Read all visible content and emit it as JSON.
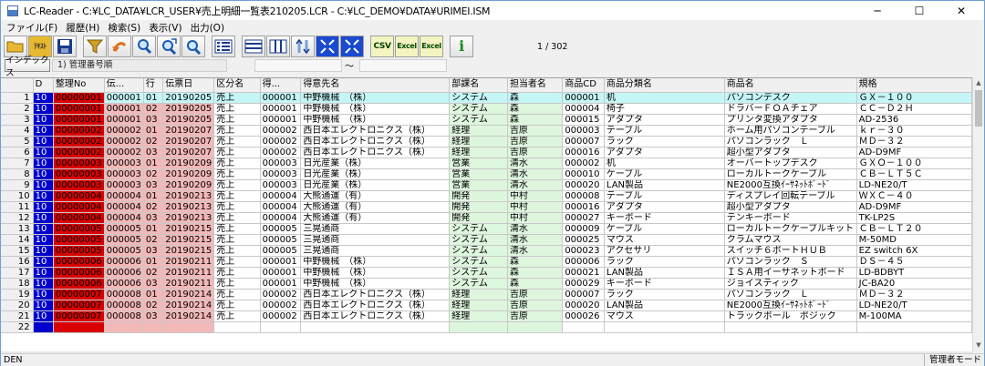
{
  "window": {
    "title": "LC-Reader - C:¥LC_DATA¥LCR_USER¥売上明細一覧表210205.LCR - C:¥LC_DEMO¥DATA¥URIMEI.ISM",
    "minimize": "─",
    "maximize": "☐",
    "close": "✕"
  },
  "menu": [
    "ファイル(F)",
    "履歴(H)",
    "検索(S)",
    "表示(V)",
    "出力(O)"
  ],
  "toolbar": {
    "buttons": [
      {
        "name": "folder-open-icon"
      },
      {
        "name": "folder-text-icon",
        "label": "ﾃｷｽﾄ"
      },
      {
        "name": "save-icon"
      },
      {
        "name": "filter-icon"
      },
      {
        "name": "undo-icon"
      },
      {
        "name": "search-icon"
      },
      {
        "name": "search-next-icon"
      },
      {
        "name": "search-prev-icon"
      },
      {
        "name": "list-icon"
      },
      {
        "name": "row-height-icon"
      },
      {
        "name": "column-width-icon"
      },
      {
        "name": "swap-icon"
      },
      {
        "name": "expand-icon"
      },
      {
        "name": "fit-icon"
      },
      {
        "name": "csv-icon",
        "label": "CSV"
      },
      {
        "name": "excel-icon",
        "label": "Excel"
      },
      {
        "name": "excel-template-icon",
        "label": "Excel"
      },
      {
        "name": "info-icon",
        "label": "i"
      }
    ],
    "page_indicator": "1 / 302"
  },
  "index": {
    "button": "インデックス",
    "name": "1) 管理番号順",
    "range_from": "",
    "range_sep": "～",
    "range_to": ""
  },
  "grid": {
    "columns": [
      "D",
      "整理No",
      "伝...",
      "行",
      "伝票日",
      "区分名",
      "得...",
      "得意先名",
      "部課名",
      "担当者名",
      "商品CD",
      "商品分類名",
      "商品名",
      "規格"
    ],
    "rows": [
      [
        "1",
        "10",
        "00000001",
        "000001",
        "01",
        "20190205",
        "売上",
        "000001",
        "中野機械　（株）",
        "システム",
        "森",
        "000001",
        "机",
        "パソコンデスク",
        "ＧＸ－１００"
      ],
      [
        "2",
        "10",
        "00000001",
        "000001",
        "02",
        "20190205",
        "売上",
        "000001",
        "中野機械　（株）",
        "システム",
        "森",
        "000004",
        "椅子",
        "ドラバーＦＯＡチェア",
        "ＣＣ－Ｄ２Ｈ"
      ],
      [
        "3",
        "10",
        "00000001",
        "000001",
        "03",
        "20190205",
        "売上",
        "000001",
        "中野機械　（株）",
        "システム",
        "森",
        "000015",
        "アダプタ",
        "プリンタ変換アダプタ",
        "AD-2536"
      ],
      [
        "4",
        "10",
        "00000002",
        "000002",
        "01",
        "20190207",
        "売上",
        "000002",
        "西日本エレクトロニクス（株）",
        "経理",
        "吉原",
        "000003",
        "テーブル",
        "ホーム用パソコンテーブル",
        "ｋｒ－３０"
      ],
      [
        "5",
        "10",
        "00000002",
        "000002",
        "02",
        "20190207",
        "売上",
        "000002",
        "西日本エレクトロニクス（株）",
        "経理",
        "吉原",
        "000007",
        "ラック",
        "パソコンラック　Ｌ",
        "ＭＤ－３２"
      ],
      [
        "6",
        "10",
        "00000002",
        "000002",
        "03",
        "20190207",
        "売上",
        "000002",
        "西日本エレクトロニクス（株）",
        "経理",
        "吉原",
        "000016",
        "アダプタ",
        "超小型アダプタ",
        "AD-D9MF"
      ],
      [
        "7",
        "10",
        "00000003",
        "000003",
        "01",
        "20190209",
        "売上",
        "000003",
        "日光産業（株）",
        "営業",
        "清水",
        "000002",
        "机",
        "オーバートップデスク",
        "ＧＸＯ－１００"
      ],
      [
        "8",
        "10",
        "00000003",
        "000003",
        "02",
        "20190209",
        "売上",
        "000003",
        "日光産業（株）",
        "営業",
        "清水",
        "000010",
        "ケーブル",
        "ローカルトークケーブル",
        "ＣＢ－ＬＴ５Ｃ"
      ],
      [
        "9",
        "10",
        "00000003",
        "000003",
        "03",
        "20190209",
        "売上",
        "000003",
        "日光産業（株）",
        "営業",
        "清水",
        "000020",
        "LAN製品",
        "NE2000互換ｲｰｻﾈｯﾄﾎﾞｰﾄﾞ",
        "LD-NE20/T"
      ],
      [
        "10",
        "10",
        "00000004",
        "000004",
        "01",
        "20190213",
        "売上",
        "000004",
        "大熊通運（有）",
        "開発",
        "中村",
        "000008",
        "テーブル",
        "ディスプレイ回転テーブル",
        "ＷＸＣ－４０"
      ],
      [
        "11",
        "10",
        "00000004",
        "000004",
        "02",
        "20190213",
        "売上",
        "000004",
        "大熊通運（有）",
        "開発",
        "中村",
        "000016",
        "アダプタ",
        "超小型アダプタ",
        "AD-D9MF"
      ],
      [
        "12",
        "10",
        "00000004",
        "000004",
        "03",
        "20190213",
        "売上",
        "000004",
        "大熊通運（有）",
        "開発",
        "中村",
        "000027",
        "キーボード",
        "テンキーボード",
        "TK-LP2S"
      ],
      [
        "13",
        "10",
        "00000005",
        "000005",
        "01",
        "20190215",
        "売上",
        "000005",
        "三晃通商",
        "システム",
        "清水",
        "000009",
        "ケーブル",
        "ローカルトークケーブルキット",
        "ＣＢ－ＬＴ２０"
      ],
      [
        "14",
        "10",
        "00000005",
        "000005",
        "02",
        "20190215",
        "売上",
        "000005",
        "三晃通商",
        "システム",
        "清水",
        "000025",
        "マウス",
        "クラムマウス",
        "M-50MD"
      ],
      [
        "15",
        "10",
        "00000005",
        "000005",
        "03",
        "20190215",
        "売上",
        "000005",
        "三晃通商",
        "システム",
        "清水",
        "000023",
        "アクセサリ",
        "スイッチ６ポートＨＵＢ",
        "EZ switch 6X"
      ],
      [
        "16",
        "10",
        "00000006",
        "000006",
        "01",
        "20190211",
        "売上",
        "000001",
        "中野機械　（株）",
        "システム",
        "森",
        "000006",
        "ラック",
        "パソコンラック　Ｓ",
        "ＤＳ－４５"
      ],
      [
        "17",
        "10",
        "00000006",
        "000006",
        "02",
        "20190211",
        "売上",
        "000001",
        "中野機械　（株）",
        "システム",
        "森",
        "000021",
        "LAN製品",
        "ＩＳＡ用イーサネットボード",
        "LD-BDBYT"
      ],
      [
        "18",
        "10",
        "00000006",
        "000006",
        "03",
        "20190211",
        "売上",
        "000001",
        "中野機械　（株）",
        "システム",
        "森",
        "000029",
        "キーボード",
        "ジョイスティック",
        "JC-BA20"
      ],
      [
        "19",
        "10",
        "00000007",
        "000008",
        "01",
        "20190214",
        "売上",
        "000002",
        "西日本エレクトロニクス（株）",
        "経理",
        "吉原",
        "000007",
        "ラック",
        "パソコンラック　Ｌ",
        "ＭＤ－３２"
      ],
      [
        "20",
        "10",
        "00000007",
        "000008",
        "02",
        "20190214",
        "売上",
        "000002",
        "西日本エレクトロニクス（株）",
        "経理",
        "吉原",
        "000020",
        "LAN製品",
        "NE2000互換ｲｰｻﾈｯﾄﾎﾞｰﾄﾞ",
        "LD-NE20/T"
      ],
      [
        "21",
        "10",
        "00000007",
        "000008",
        "03",
        "20190214",
        "売上",
        "000002",
        "西日本エレクトロニクス（株）",
        "経理",
        "吉原",
        "000026",
        "マウス",
        "トラックボール　ポジック",
        "M-100MA"
      ],
      [
        "22",
        "",
        "",
        "",
        "",
        "",
        "",
        "",
        "",
        "",
        "",
        "",
        "",
        "",
        ""
      ]
    ]
  },
  "status": {
    "left": "DEN",
    "mode": "管理者モード"
  },
  "colors": {
    "d_col": "#0000cc",
    "seiri_col": "#d80000",
    "pink_col": "#f3b8b8",
    "green_col": "#def6de",
    "current_row": "#c4f6f6"
  }
}
